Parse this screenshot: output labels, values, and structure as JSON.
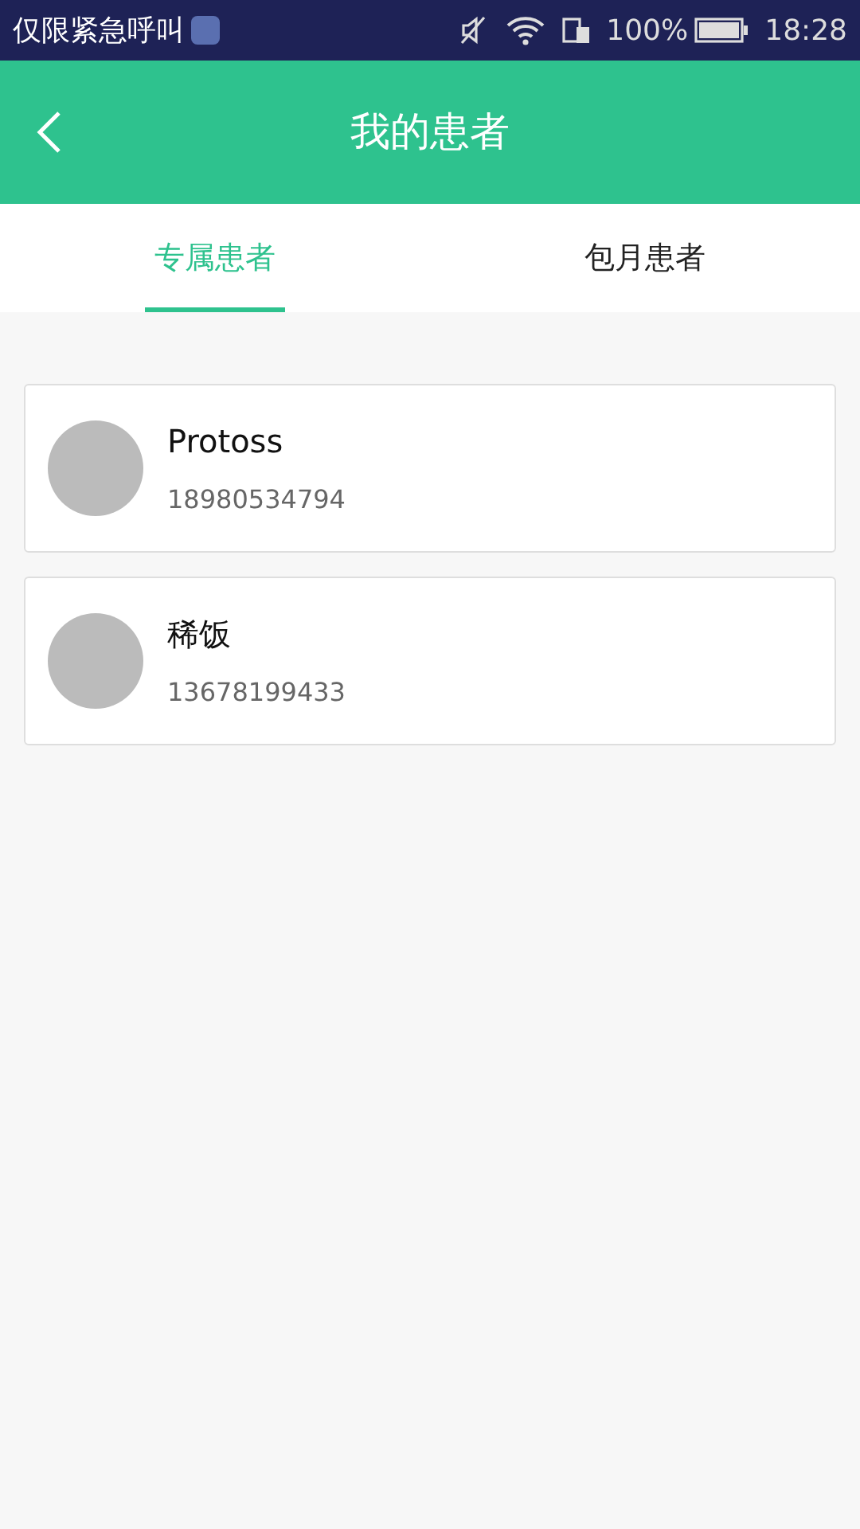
{
  "status_bar": {
    "carrier": "仅限紧急呼叫",
    "battery": "100%",
    "time": "18:28"
  },
  "header": {
    "title": "我的患者"
  },
  "tabs": [
    {
      "label": "专属患者",
      "selected": true
    },
    {
      "label": "包月患者",
      "selected": false
    }
  ],
  "patients": [
    {
      "name": "Protoss",
      "phone": "18980534794"
    },
    {
      "name": "稀饭",
      "phone": "13678199433"
    }
  ]
}
